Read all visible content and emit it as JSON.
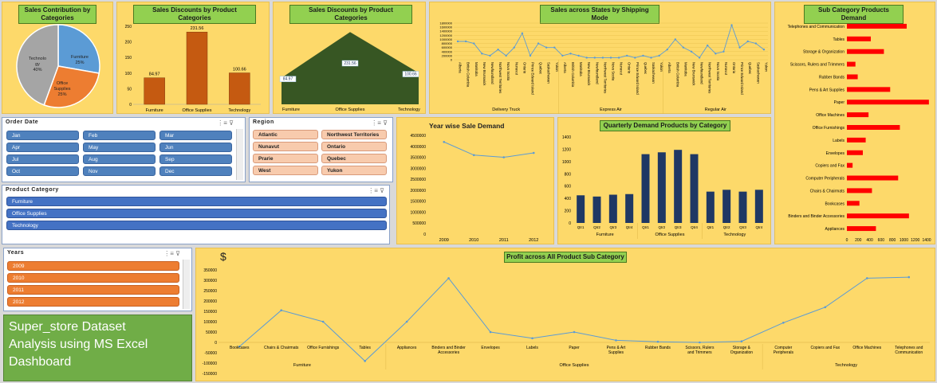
{
  "pie": {
    "title": "Sales Contribution by Categories",
    "slices": [
      {
        "label": "Furniture",
        "pct": "25%",
        "value": 25,
        "color": "#5b9bd5"
      },
      {
        "label": "Office Supplies",
        "pct": "25%",
        "value": 25,
        "color": "#ed7d31"
      },
      {
        "label": "Technology",
        "pct": "40%",
        "value": 40,
        "color": "#a5a5a5"
      }
    ],
    "tech_label_lines": [
      "Technolo",
      "gy",
      "40%"
    ],
    "office_label_lines": [
      "Office",
      "Supplies",
      "25%"
    ],
    "furniture_label_lines": [
      "Furniture",
      "25%"
    ]
  },
  "discount_bar": {
    "title": "Sales Discounts by Product Categories",
    "chart_data": {
      "type": "bar",
      "categories": [
        "Furniture",
        "Office Supplies",
        "Technology"
      ],
      "values": [
        84.97,
        231.56,
        100.66
      ],
      "ylim": [
        0,
        250
      ],
      "yticks": [
        "250",
        "200",
        "150",
        "100",
        "50",
        "0"
      ]
    }
  },
  "discount_area": {
    "title": "Sales Discounts by Product Categories",
    "chart_data": {
      "type": "area",
      "categories": [
        "Furniture",
        "Office Supplies",
        "Technology"
      ],
      "values": [
        84.97,
        231.56,
        100.66
      ],
      "ylim": [
        0,
        250
      ],
      "labels": [
        "84.97",
        "231.56",
        "100.66"
      ]
    }
  },
  "states": {
    "title": "Sales across States by Shipping Mode",
    "yticks": [
      "1800000",
      "1600000",
      "1400000",
      "1200000",
      "1000000",
      "800000",
      "600000",
      "400000",
      "200000",
      "0"
    ],
    "chart_data": {
      "type": "line",
      "groups": [
        {
          "name": "Delivery Truck",
          "states": [
            "Alberta",
            "British Columbia",
            "Manitoba",
            "New Brunswick",
            "Newfoundland",
            "Northwest Territories",
            "Nova Scotia",
            "Nunavut",
            "Ontario",
            "Prince Edward Island",
            "Quebec",
            "Saskachewan",
            "Yukon"
          ],
          "values": [
            900000,
            900000,
            800000,
            300000,
            200000,
            500000,
            200000,
            600000,
            1300000,
            200000,
            800000,
            600000,
            600000
          ]
        },
        {
          "name": "Express Air",
          "states": [
            "Alberta",
            "British Columbia",
            "Manitoba",
            "New Brunswick",
            "Newfoundland",
            "Northwest Territories",
            "Nova Scotia",
            "Nunavut",
            "Ontario",
            "Prince Edward Island",
            "Quebec",
            "Saskachewan",
            "Yukon"
          ],
          "values": [
            200000,
            300000,
            200000,
            100000,
            100000,
            100000,
            100000,
            100000,
            200000,
            100000,
            200000,
            100000,
            200000
          ]
        },
        {
          "name": "Regular Air",
          "states": [
            "Alberta",
            "British Columbia",
            "Manitoba",
            "New Brunswick",
            "Newfoundland",
            "Northwest Territories",
            "Nova Scotia",
            "Nunavut",
            "Ontario",
            "Prince Edward Island",
            "Quebec",
            "Saskachewan",
            "Yukon"
          ],
          "values": [
            500000,
            1000000,
            600000,
            400000,
            100000,
            700000,
            300000,
            400000,
            1700000,
            600000,
            900000,
            800000,
            500000
          ]
        }
      ],
      "ylim": [
        0,
        1800000
      ]
    }
  },
  "subcat": {
    "title": "Sub Category Products Demand",
    "xticks": [
      "0",
      "200",
      "400",
      "600",
      "800",
      "1000",
      "1200",
      "1400"
    ],
    "chart_data": {
      "type": "bar",
      "categories": [
        "Telephones and Communication",
        "Tables",
        "Storage & Organization",
        "Scissors, Rulers and Trimmers",
        "Rubber Bands",
        "Pens & Art Supplies",
        "Paper",
        "Office Machines",
        "Office Furnishings",
        "Labels",
        "Envelopes",
        "Copiers and Fax",
        "Computer Peripherals",
        "Chairs & Chairmats",
        "Bookcases",
        "Binders and Binder Accessories",
        "Appliances"
      ],
      "values": [
        1050,
        420,
        650,
        150,
        190,
        760,
        1440,
        380,
        930,
        330,
        280,
        100,
        900,
        440,
        220,
        1090,
        510
      ],
      "xlim": [
        0,
        1400
      ]
    }
  },
  "order_date": {
    "title": "Order Date",
    "months": [
      "Jan",
      "Feb",
      "Mar",
      "Apr",
      "May",
      "Jun",
      "Jul",
      "Aug",
      "Sep",
      "Oct",
      "Nov",
      "Dec"
    ]
  },
  "region": {
    "title": "Region",
    "items": [
      "Atlantic",
      "Northwest Territories",
      "Nunavut",
      "Ontario",
      "Prarie",
      "Quebec",
      "West",
      "Yukon"
    ]
  },
  "yearwise": {
    "title": "Year wise Sale Demand",
    "yticks": [
      "4500000",
      "4000000",
      "3500000",
      "3000000",
      "2500000",
      "2000000",
      "1500000",
      "1000000",
      "500000",
      "0"
    ],
    "chart_data": {
      "type": "line",
      "x": [
        "2009",
        "2010",
        "2011",
        "2012"
      ],
      "values": [
        4200000,
        3600000,
        3500000,
        3700000
      ],
      "ylim": [
        0,
        4500000
      ]
    }
  },
  "quarterly": {
    "title": "Quarterly Demand Products by Category",
    "yticks": [
      "1400",
      "1200",
      "1000",
      "800",
      "600",
      "400",
      "200",
      "0"
    ],
    "chart_data": {
      "type": "bar",
      "groups": [
        "Furniture",
        "Office Supplies",
        "Technology"
      ],
      "quarters": [
        "Qtr1",
        "Qtr2",
        "Qtr3",
        "Qtr4"
      ],
      "values": [
        [
          450,
          430,
          460,
          470
        ],
        [
          1120,
          1150,
          1190,
          1120
        ],
        [
          510,
          540,
          510,
          540
        ]
      ],
      "ylim": [
        0,
        1400
      ]
    }
  },
  "product_category": {
    "title": "Product Category",
    "items": [
      "Furniture",
      "Office Supplies",
      "Technology"
    ]
  },
  "years": {
    "title": "Years",
    "items": [
      "2009",
      "2010",
      "2011",
      "2012"
    ]
  },
  "profit": {
    "title": "Profit across All Product Sub Category",
    "currency": "$",
    "yticks": [
      "350000",
      "300000",
      "250000",
      "200000",
      "150000",
      "100000",
      "50000",
      "0",
      "-50000",
      "-100000",
      "-150000"
    ],
    "chart_data": {
      "type": "line",
      "x": [
        "Bookcases",
        "Chairs & Chairmats",
        "Office Furnishings",
        "Tables",
        "Appliances",
        "Binders and Binder Accessories",
        "Envelopes",
        "Labels",
        "Paper",
        "Pens & Art Supplies",
        "Rubber Bands",
        "Scissors, Rulers and Trimmers",
        "Storage & Organization",
        "Computer Peripherals",
        "Copiers and Fax",
        "Office Machines",
        "Telephones and Communication"
      ],
      "values": [
        -20000,
        155000,
        100000,
        -90000,
        100000,
        310000,
        50000,
        20000,
        50000,
        10000,
        3000,
        0,
        5000,
        95000,
        170000,
        310000,
        315000
      ],
      "groups": [
        {
          "name": "Furniture",
          "count": 4
        },
        {
          "name": "Office Supplies",
          "count": 9
        },
        {
          "name": "Technology",
          "count": 4
        }
      ],
      "ylim": [
        -150000,
        350000
      ]
    }
  },
  "banner": {
    "line1": "Super_store  Dataset",
    "line2": "Analysis  using  MS Excel",
    "line3": "Dashboard"
  },
  "colors": {
    "panel_bg": "#fdd96a",
    "title_bg": "#92d050",
    "bar_brown": "#c55a11",
    "area_green": "#375623",
    "bar_navy": "#1f3864",
    "bar_red": "#ff0000",
    "line_blue": "#5b9bd5"
  }
}
